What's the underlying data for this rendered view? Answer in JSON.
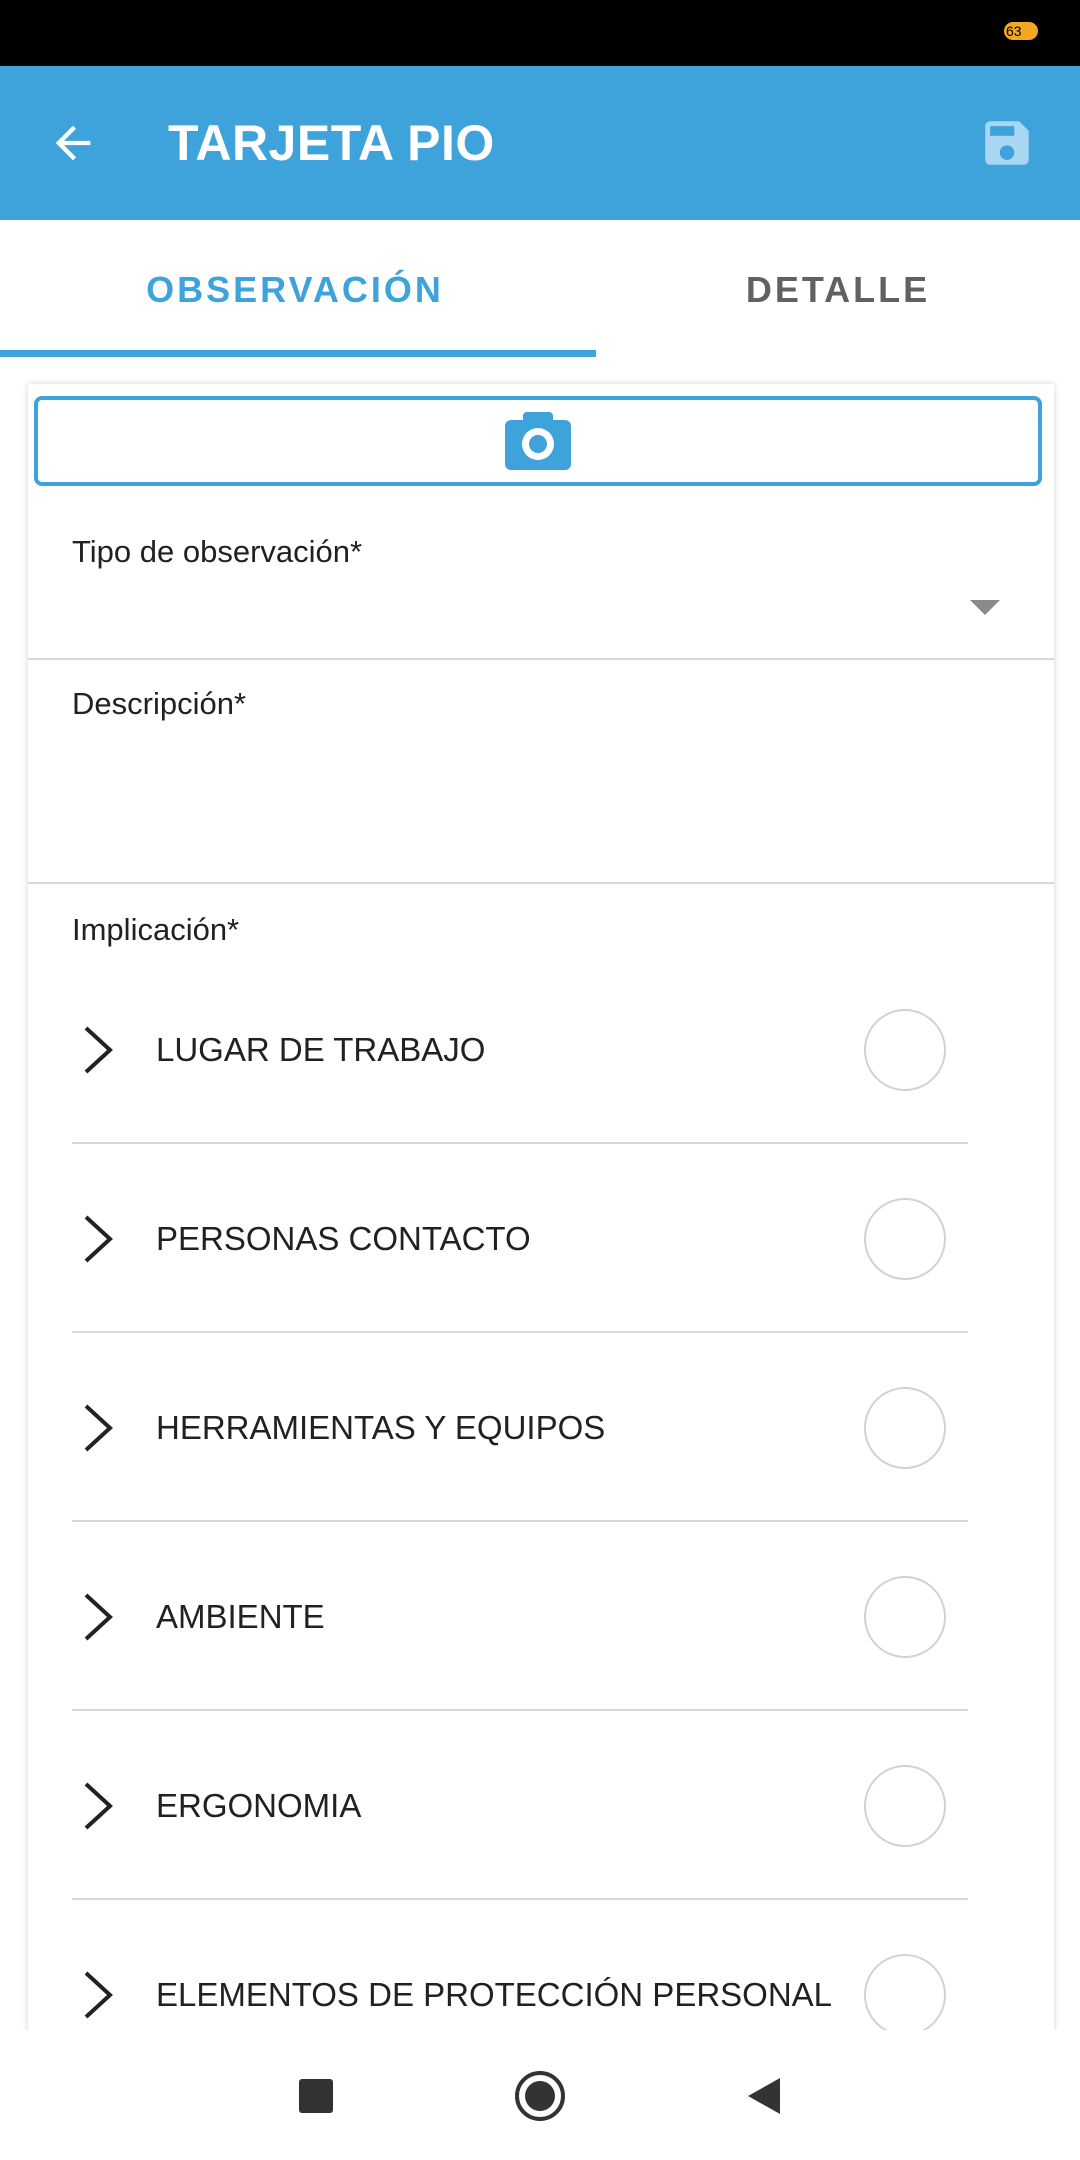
{
  "status_bar": {
    "battery_level": "63"
  },
  "app_bar": {
    "title": "TARJETA PIO",
    "back_icon": "arrow-left-icon",
    "save_icon": "floppy-disk-icon",
    "color": "#3ea2db"
  },
  "tabs": [
    {
      "label": "OBSERVACIÓN",
      "active": true
    },
    {
      "label": "DETALLE",
      "active": false
    }
  ],
  "form": {
    "photo_button_icon": "camera-icon",
    "tipo_label": "Tipo de observación*",
    "descripcion_label": "Descripción*",
    "implicacion_label": "Implicación*",
    "implicacion_items": [
      {
        "label": "LUGAR DE TRABAJO"
      },
      {
        "label": "PERSONAS CONTACTO"
      },
      {
        "label": "HERRAMIENTAS Y EQUIPOS"
      },
      {
        "label": "AMBIENTE"
      },
      {
        "label": "ERGONOMIA"
      },
      {
        "label": "ELEMENTOS DE PROTECCIÓN PERSONAL"
      }
    ]
  },
  "nav_bar": {
    "recents_icon": "square-recents-icon",
    "home_icon": "circle-home-icon",
    "back_icon": "triangle-back-icon"
  }
}
